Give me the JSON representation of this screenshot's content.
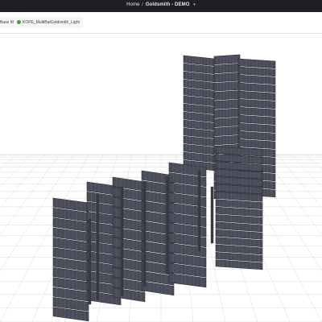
{
  "header": {
    "home_label": "Home",
    "separator": "/",
    "project_name": "Goldsmith - DEMO",
    "dropdown_icon": "chevron-down-icon"
  },
  "model_bar": {
    "base_model_label": "Base Model",
    "model_name": "KOPE_MultiBatGoldsmith_Light",
    "status_color": "#38a34a"
  },
  "viewport": {
    "background_color": "#ffffff",
    "grid_color": "#d9d9dd",
    "panel_color": "#4a4c5a",
    "panel_edge_color": "#2a2b33"
  }
}
